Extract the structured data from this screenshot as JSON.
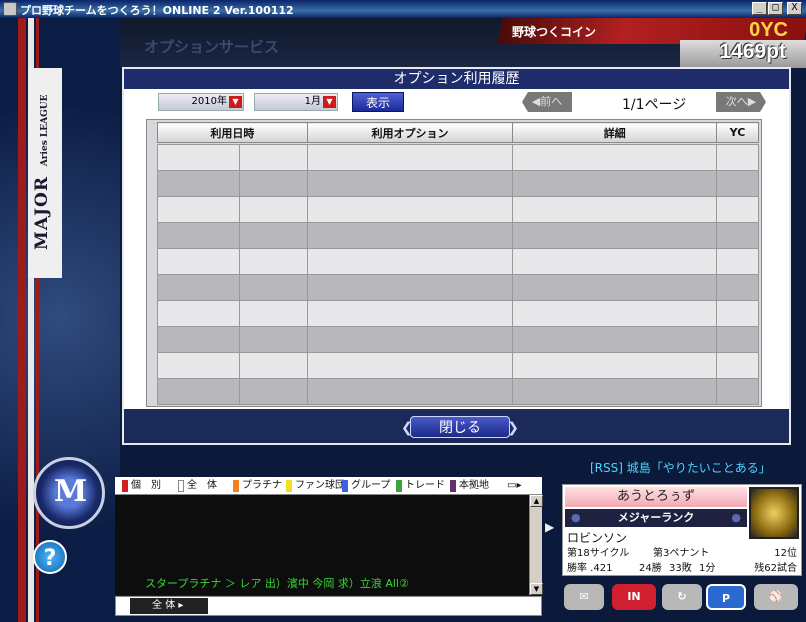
{
  "window": {
    "title": "プロ野球チームをつくろう！ONLINE 2 Ver.100112",
    "minimize": "_",
    "maximize": "□",
    "close": "X"
  },
  "sidebar": {
    "league_major": "MAJOR",
    "league_name": "Aries LEAGUE"
  },
  "header": {
    "service_title": "オプションサービス",
    "coin_label": "野球つくコイン",
    "coin_value": "0YC",
    "points_value": "1469pt"
  },
  "dialog": {
    "title": "オプション利用履歴",
    "year_select": "2010年",
    "month_select": "1月",
    "show_button": "表示",
    "prev_button": "◀前へ",
    "next_button": "次へ▶",
    "page_indicator": "1/1ページ",
    "columns": [
      "利用日時",
      "利用オプション",
      "詳細",
      "YC"
    ],
    "close_button": "閉じる"
  },
  "rss": {
    "text": "[RSS] 城島「やりたいことある」"
  },
  "chat": {
    "tabs": [
      {
        "label": "個　別",
        "color": "#d02020"
      },
      {
        "label": "全　体",
        "color": "#ffffff"
      },
      {
        "label": "プラチナ",
        "color": "#f08020"
      },
      {
        "label": "ファン球団",
        "color": "#f0e020"
      },
      {
        "label": "グループ",
        "color": "#4060e0"
      },
      {
        "label": "トレード",
        "color": "#40a040"
      },
      {
        "label": "本拠地",
        "color": "#603070"
      }
    ],
    "message": "スタープラチナ ＞ レア 出）濱中 今岡 求）立浪 All②",
    "scope_select": "全 体"
  },
  "player_card": {
    "team_name": "あうとろぅず",
    "rank": "メジャーランク",
    "owner": "ロビンソン",
    "cycle": "第18サイクル",
    "pennant": "第3ペナント",
    "position": "12位",
    "win_rate": "勝率 .421",
    "wins": "24勝",
    "losses": "33敗",
    "draws": "1分",
    "remaining": "残62試合"
  },
  "actions": {
    "mail": "✉",
    "login": "IN",
    "refresh": "↻",
    "points": "P"
  }
}
